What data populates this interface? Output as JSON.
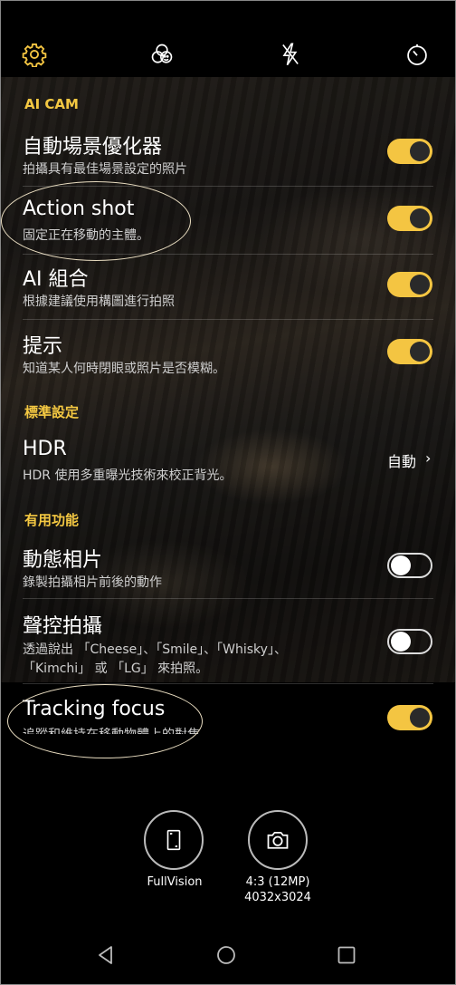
{
  "sections": {
    "ai_cam": "AI CAM",
    "standard": "標準設定",
    "useful": "有用功能"
  },
  "settings": [
    {
      "title": "自動場景優化器",
      "subtitle": "拍攝具有最佳場景設定的照片",
      "toggle": "on"
    },
    {
      "title": "Action shot",
      "subtitle": "固定正在移動的主體。",
      "toggle": "on"
    },
    {
      "title": "AI 組合",
      "subtitle": "根據建議使用構圖進行拍照",
      "toggle": "on"
    },
    {
      "title": "提示",
      "subtitle": "知道某人何時閉眼或照片是否模糊。",
      "toggle": "on"
    },
    {
      "title": "HDR",
      "subtitle": "HDR 使用多重曝光技術來校正背光。",
      "value": "自動"
    },
    {
      "title": "動態相片",
      "subtitle": "錄製拍攝相片前後的動作",
      "toggle": "off"
    },
    {
      "title": "聲控拍攝",
      "subtitle": "透過說出 「Cheese」、「Smile」、「Whisky」、",
      "subtitle2": "「Kimchi」 或 「LG」 來拍照。",
      "toggle": "off"
    },
    {
      "title": "Tracking focus",
      "subtitle": "追蹤和維持在移動物體上的對焦",
      "toggle": "on"
    }
  ],
  "modes": {
    "fullvision": "FullVision",
    "ratio": "4:3 (12MP)",
    "resolution": "4032x3024"
  },
  "colors": {
    "accent": "#f4c542",
    "section": "#f4c842"
  },
  "icons": [
    "gear-icon",
    "filter-icon",
    "flash-off-icon",
    "timer-icon",
    "fullvision-icon",
    "camera-icon",
    "back-icon",
    "home-icon",
    "recents-icon"
  ]
}
